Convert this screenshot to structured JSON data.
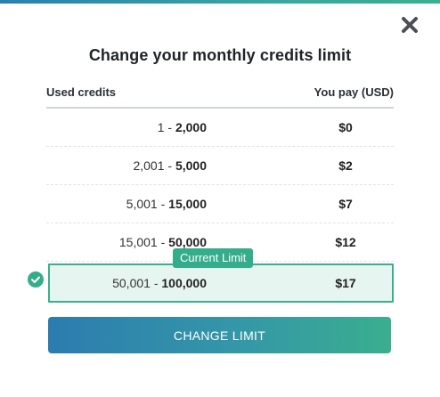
{
  "dialog": {
    "title": "Change your monthly credits limit",
    "close_icon": "close-icon"
  },
  "table": {
    "headers": {
      "used_credits": "Used credits",
      "you_pay": "You pay (USD)"
    },
    "rows": [
      {
        "from": "1",
        "to": "2,000",
        "price": "$0"
      },
      {
        "from": "2,001",
        "to": "5,000",
        "price": "$2"
      },
      {
        "from": "5,001",
        "to": "15,000",
        "price": "$7"
      },
      {
        "from": "15,001",
        "to": "50,000",
        "price": "$12"
      },
      {
        "from": "50,001",
        "to": "100,000",
        "price": "$17",
        "current": true
      }
    ],
    "current_badge": "Current Limit",
    "separator": " - "
  },
  "action": {
    "button_label": "CHANGE LIMIT"
  },
  "colors": {
    "accent": "#34ad8a",
    "accent_blue": "#2c7cae",
    "current_row_bg": "#e7f5f1"
  }
}
